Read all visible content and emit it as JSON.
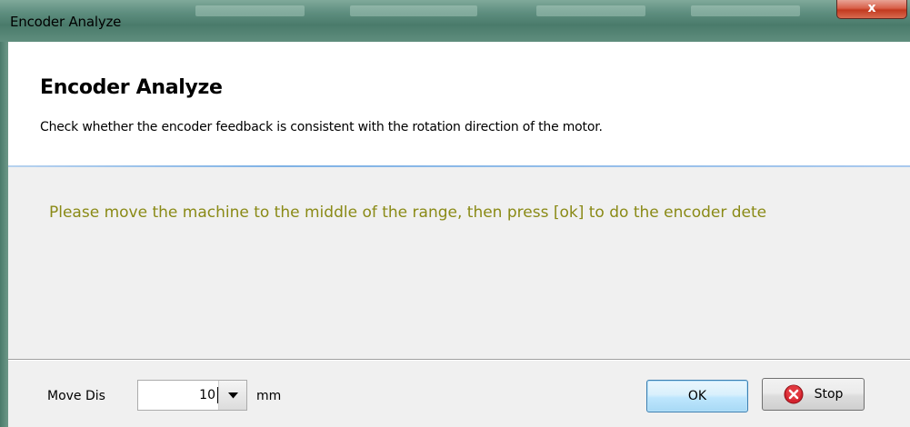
{
  "window": {
    "title": "Encoder Analyze",
    "close_label": "x"
  },
  "header": {
    "title": "Encoder Analyze",
    "description": "Check whether the encoder feedback is consistent with the rotation direction of the motor."
  },
  "body": {
    "message": "Please move the machine to the middle of the range, then press [ok] to do the encoder dete",
    "message_color": "#8a8a16"
  },
  "footer": {
    "move_label": "Move Dis",
    "move_value": "10",
    "unit": "mm",
    "ok_label": "OK",
    "stop_label": "Stop"
  },
  "icons": {
    "stop": "stop-icon",
    "dropdown": "chevron-down-icon"
  }
}
